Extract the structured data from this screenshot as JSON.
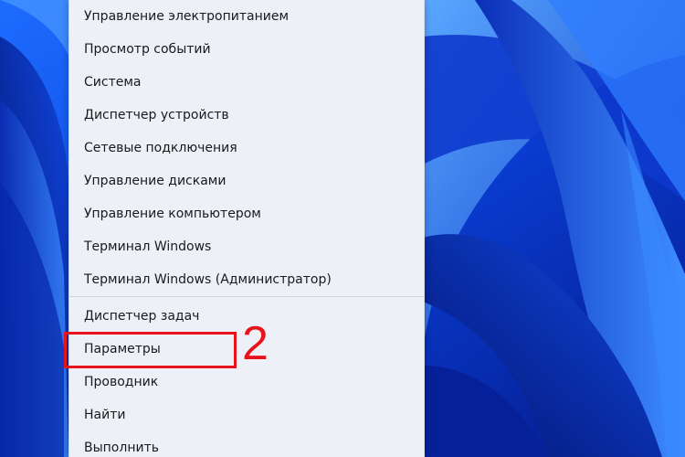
{
  "menu": {
    "items": [
      {
        "label": "Управление электропитанием"
      },
      {
        "label": "Просмотр событий"
      },
      {
        "label": "Система"
      },
      {
        "label": "Диспетчер устройств"
      },
      {
        "label": "Сетевые подключения"
      },
      {
        "label": "Управление дисками"
      },
      {
        "label": "Управление компьютером"
      },
      {
        "label": "Терминал Windows"
      },
      {
        "label": "Терминал Windows (Администратор)"
      },
      {
        "label": "Диспетчер задач"
      },
      {
        "label": "Параметры"
      },
      {
        "label": "Проводник"
      },
      {
        "label": "Найти"
      },
      {
        "label": "Выполнить"
      }
    ]
  },
  "annotation": {
    "step_number": "2",
    "color": "#e8141b"
  },
  "colors": {
    "menu_background": "#eef0f8",
    "wallpaper_base": "#0a3fd6"
  }
}
